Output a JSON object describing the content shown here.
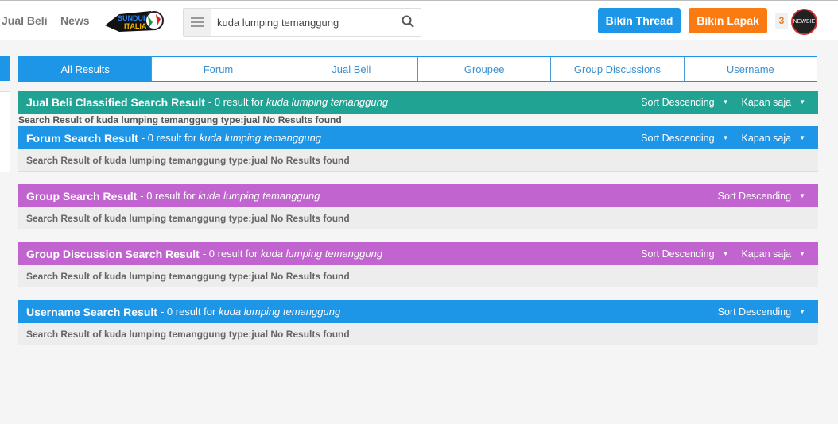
{
  "nav": {
    "jual_beli": "Jual Beli",
    "news": "News",
    "logo_text": "SUNDUL ITALIA"
  },
  "search": {
    "value": "kuda lumping temanggung"
  },
  "buttons": {
    "thread": "Bikin Thread",
    "lapak": "Bikin Lapak"
  },
  "user": {
    "notif_count": "3",
    "avatar_text": "NEWBIE"
  },
  "tabs": [
    "All Results",
    "Forum",
    "Jual Beli",
    "Groupee",
    "Group Discussions",
    "Username"
  ],
  "colors": {
    "teal": "#21a394",
    "blue": "#1e96e8",
    "purple": "#c264cf",
    "orange": "#fb7a12"
  },
  "sections": [
    {
      "title": "Jual Beli Classified Search Result",
      "count": "- 0 result for",
      "query": "kuda lumping temanggung",
      "sort": "Sort Descending",
      "time": "Kapan saja",
      "body": "Search Result of kuda lumping temanggung type:jual No Results found"
    },
    {
      "title": "Forum Search Result",
      "count": "- 0 result for",
      "query": "kuda lumping temanggung",
      "sort": "Sort Descending",
      "time": "Kapan saja",
      "body": "Search Result of kuda lumping temanggung type:jual No Results found"
    },
    {
      "title": "Group Search Result",
      "count": "- 0 result for",
      "query": "kuda lumping temanggung",
      "sort": "Sort Descending",
      "body": "Search Result of kuda lumping temanggung type:jual No Results found"
    },
    {
      "title": "Group Discussion Search Result",
      "count": "- 0 result for",
      "query": "kuda lumping temanggung",
      "sort": "Sort Descending",
      "time": "Kapan saja",
      "body": "Search Result of kuda lumping temanggung type:jual No Results found"
    },
    {
      "title": "Username Search Result",
      "count": "- 0 result for",
      "query": "kuda lumping temanggung",
      "sort": "Sort Descending",
      "body": "Search Result of kuda lumping temanggung type:jual No Results found"
    }
  ]
}
